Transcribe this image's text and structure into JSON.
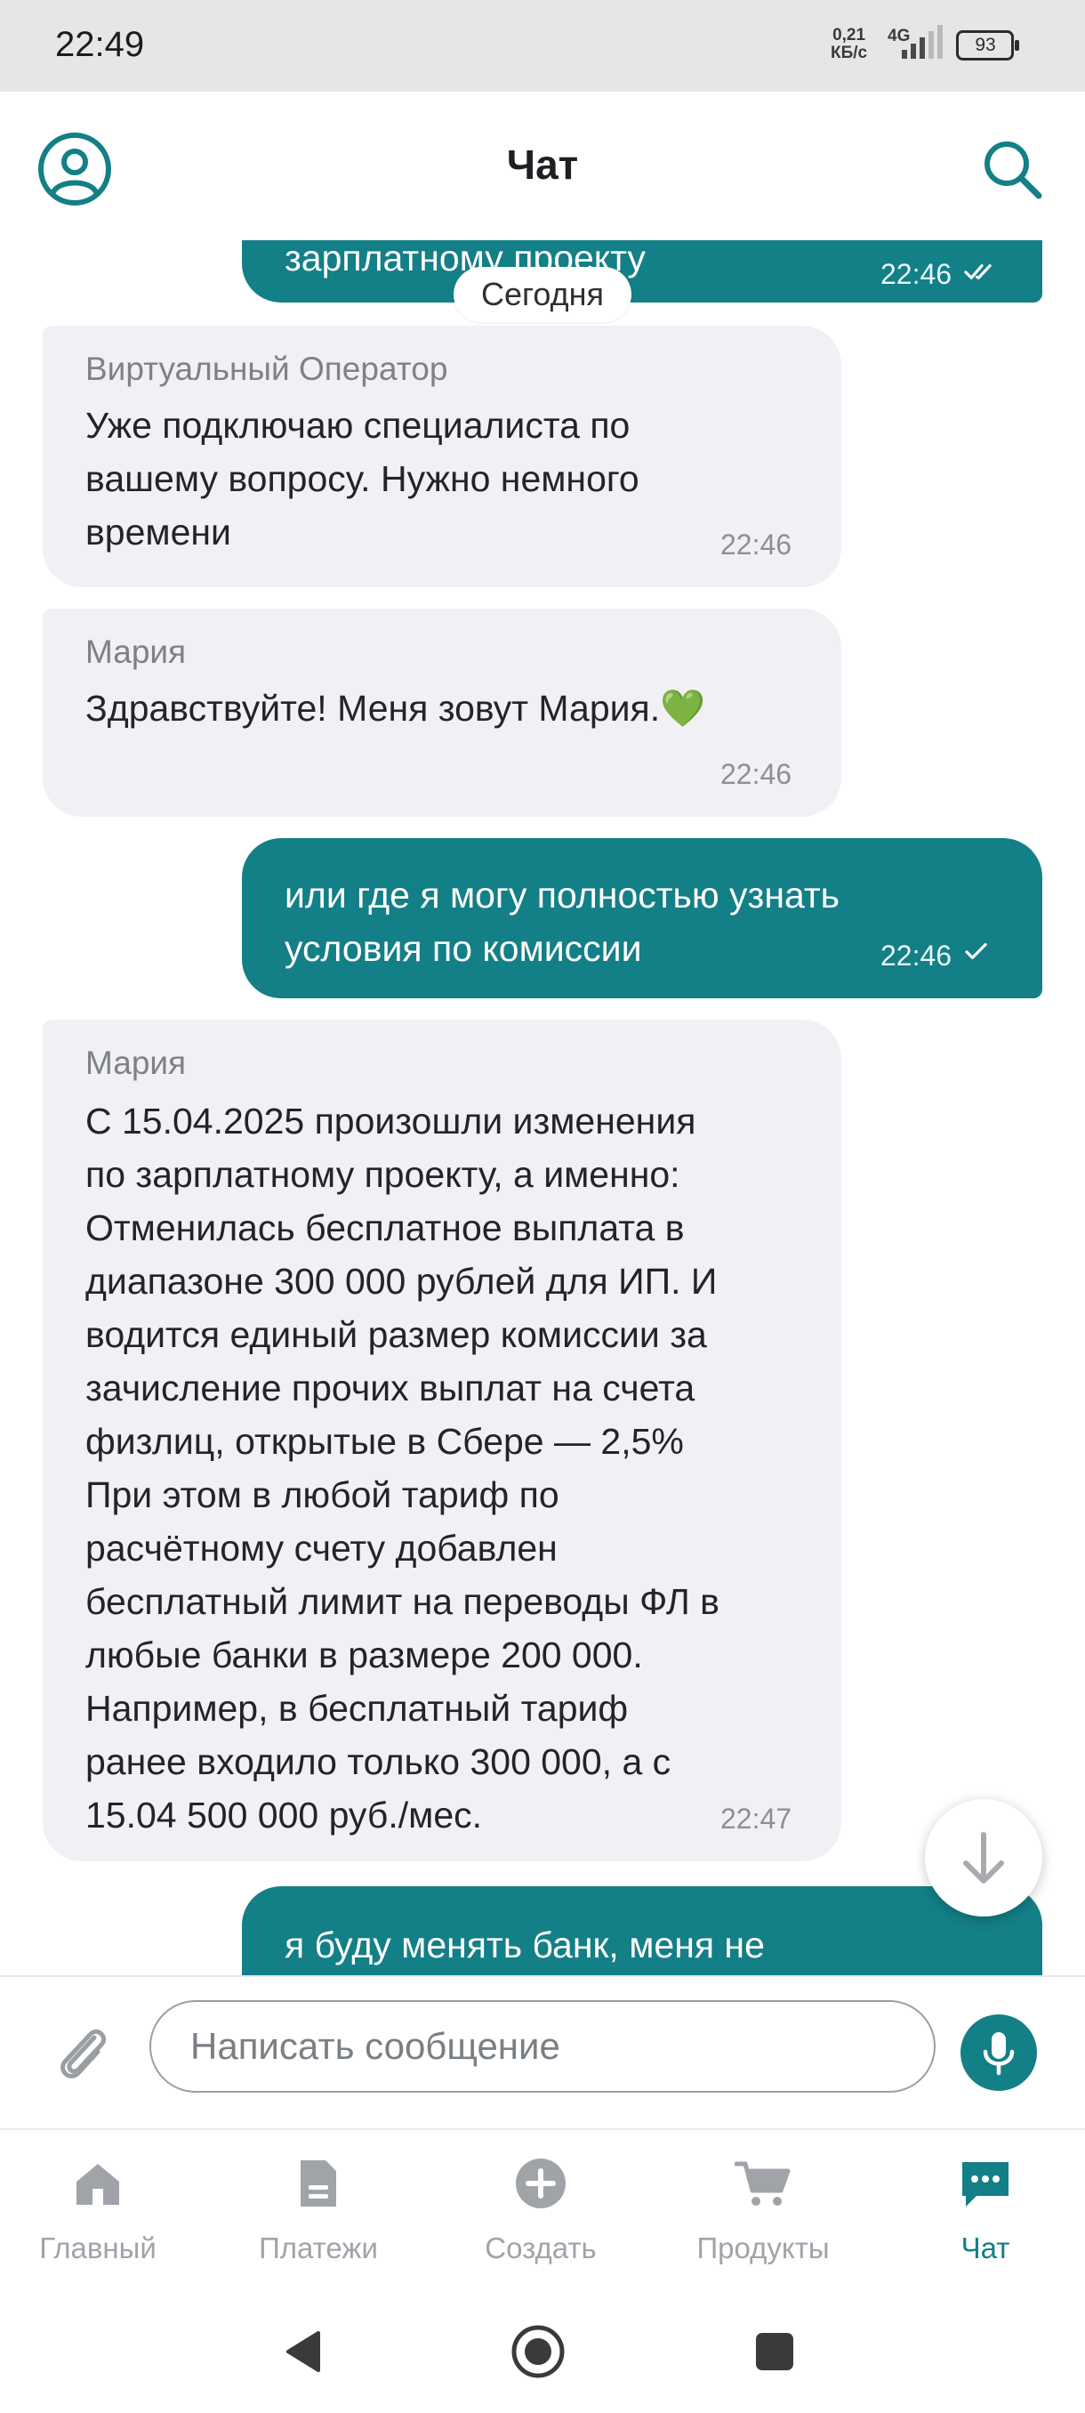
{
  "status_bar": {
    "time": "22:49",
    "net_speed_value": "0,21",
    "net_speed_unit": "КБ/с",
    "network_type": "4G",
    "battery": "93"
  },
  "header": {
    "title": "Чат"
  },
  "chat": {
    "date_divider": "Сегодня",
    "messages": [
      {
        "direction": "out",
        "lines": [
          "зарплатному проекту"
        ],
        "time": "22:46",
        "status": "read"
      },
      {
        "direction": "in",
        "sender": "Виртуальный Оператор",
        "lines": [
          "Уже подключаю специалиста по",
          "вашему вопросу. Нужно немного",
          "времени"
        ],
        "time": "22:46"
      },
      {
        "direction": "in",
        "sender": "Мария",
        "lines": [
          "Здравствуйте! Меня зовут Мария.💚"
        ],
        "time": "22:46"
      },
      {
        "direction": "out",
        "lines": [
          "или где я могу полностью узнать",
          "условия по комиссии"
        ],
        "time": "22:46",
        "status": "sent"
      },
      {
        "direction": "in",
        "sender": "Мария",
        "lines": [
          "С 15.04.2025 произошли изменения",
          "по зарплатному проекту, а именно:",
          "Отменилась бесплатное выплата в",
          "диапазоне 300 000 рублей для ИП. И",
          "водится единый размер комиссии за",
          "зачисление прочих выплат на счета",
          "физлиц, открытые в Сбере — 2,5%",
          "При этом в любой тариф по",
          "расчётному счету добавлен",
          "бесплатный лимит на переводы ФЛ в",
          "любые банки в размере 200 000.",
          "Например, в бесплатный тариф",
          "ранее входило только 300 000, а с",
          "15.04 500 000 руб./мес."
        ],
        "time": "22:47"
      },
      {
        "direction": "out",
        "lines": [
          "я буду менять банк, меня не"
        ],
        "time": "",
        "status": ""
      }
    ]
  },
  "composer": {
    "placeholder": "Написать сообщение",
    "value": ""
  },
  "bottom_nav": {
    "items": [
      {
        "label": "Главный",
        "icon": "home-icon",
        "active": false
      },
      {
        "label": "Платежи",
        "icon": "payments-icon",
        "active": false
      },
      {
        "label": "Создать",
        "icon": "plus-circle-icon",
        "active": false
      },
      {
        "label": "Продукты",
        "icon": "cart-icon",
        "active": false
      },
      {
        "label": "Чат",
        "icon": "chat-icon",
        "active": true
      }
    ]
  },
  "colors": {
    "accent": "#137f86",
    "incoming_bubble": "#f1f1f5",
    "inactive_nav": "#a0a4a9"
  }
}
